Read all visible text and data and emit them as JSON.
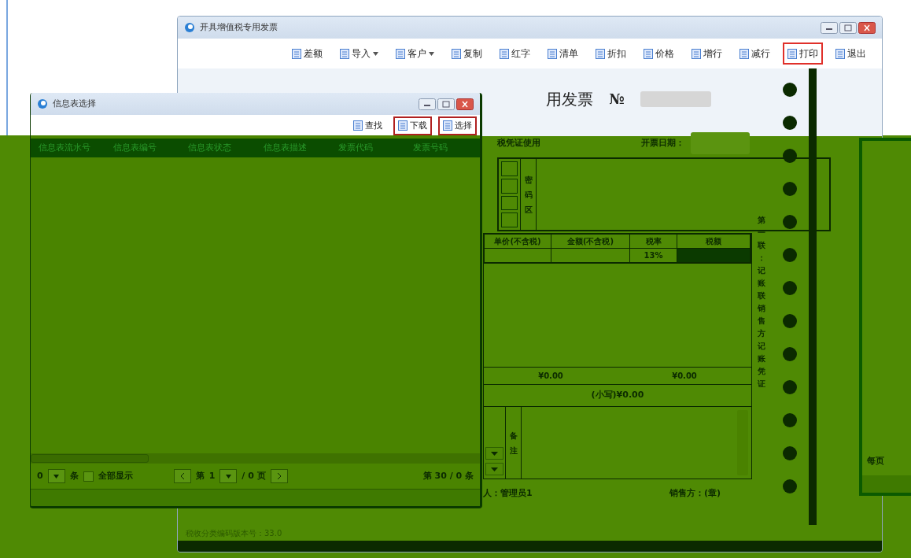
{
  "main_window": {
    "title": "开具增值税专用发票",
    "toolbar": [
      {
        "label": "差额",
        "dropdown": false,
        "highlighted": false
      },
      {
        "label": "导入",
        "dropdown": true,
        "highlighted": false
      },
      {
        "label": "客户",
        "dropdown": true,
        "highlighted": false
      },
      {
        "label": "复制",
        "dropdown": false,
        "highlighted": false
      },
      {
        "label": "红字",
        "dropdown": false,
        "highlighted": false
      },
      {
        "label": "清单",
        "dropdown": false,
        "highlighted": false
      },
      {
        "label": "折扣",
        "dropdown": false,
        "highlighted": false
      },
      {
        "label": "价格",
        "dropdown": false,
        "highlighted": false
      },
      {
        "label": "增行",
        "dropdown": false,
        "highlighted": false
      },
      {
        "label": "减行",
        "dropdown": false,
        "highlighted": false
      },
      {
        "label": "打印",
        "dropdown": false,
        "highlighted": true
      },
      {
        "label": "退出",
        "dropdown": false,
        "highlighted": false
      }
    ]
  },
  "invoice": {
    "title": "用发票",
    "number_label": "№",
    "purpose": "税凭证使用",
    "date_label": "开票日期：",
    "cipher_label": "密码区",
    "columns": [
      "单价(不含税)",
      "金额(不含税)",
      "税率",
      "税额"
    ],
    "rows": [
      [
        "",
        "",
        "13%",
        ""
      ]
    ],
    "totals": [
      "¥0.00",
      "¥0.00"
    ],
    "total_small": "(小写)¥0.00",
    "remarks_label": "备注",
    "issuer": "人：管理员1",
    "seller": "销售方：(章)",
    "copy_note": "第一联：记账联销售方记账凭证",
    "version": "税收分类编码版本号：33.0"
  },
  "dialog": {
    "title": "信息表选择",
    "toolbar": [
      {
        "label": "查找",
        "highlighted": false
      },
      {
        "label": "下载",
        "highlighted": true
      },
      {
        "label": "选择",
        "highlighted": true
      }
    ],
    "columns": [
      "信息表流水号",
      "信息表编号",
      "信息表状态",
      "信息表描述",
      "发票代码",
      "发票号码"
    ],
    "footer": {
      "page_size": "0",
      "unit": "条",
      "show_all": {
        "label": "全部显示",
        "checked": false
      },
      "page_prefix": "第",
      "page_current": "1",
      "page_suffix": "/ 0 页",
      "record_info": "第 30 / 0 条"
    }
  },
  "side_window": {
    "label": "每页"
  }
}
